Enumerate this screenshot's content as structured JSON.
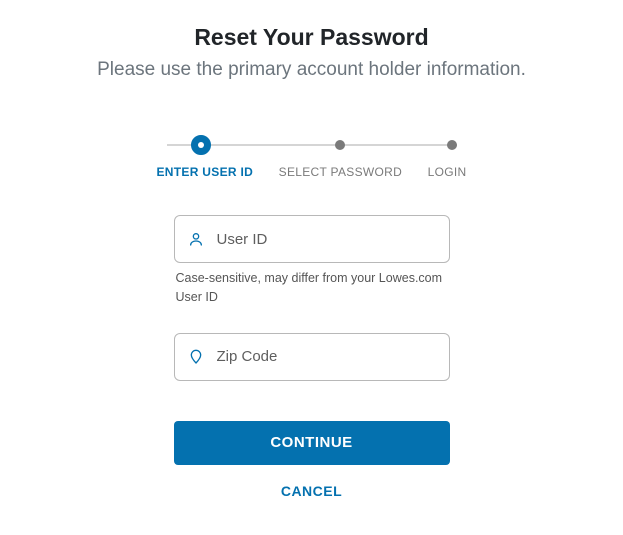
{
  "title": "Reset Your Password",
  "subtitle": "Please use the primary account holder information.",
  "stepper": {
    "steps": [
      {
        "label": "ENTER USER ID"
      },
      {
        "label": "SELECT PASSWORD"
      },
      {
        "label": "LOGIN"
      }
    ]
  },
  "form": {
    "userId": {
      "placeholder": "User ID",
      "value": "",
      "helper": "Case-sensitive, may differ from your Lowes.com User ID"
    },
    "zipCode": {
      "placeholder": "Zip Code",
      "value": ""
    },
    "continueLabel": "CONTINUE",
    "cancelLabel": "CANCEL"
  }
}
